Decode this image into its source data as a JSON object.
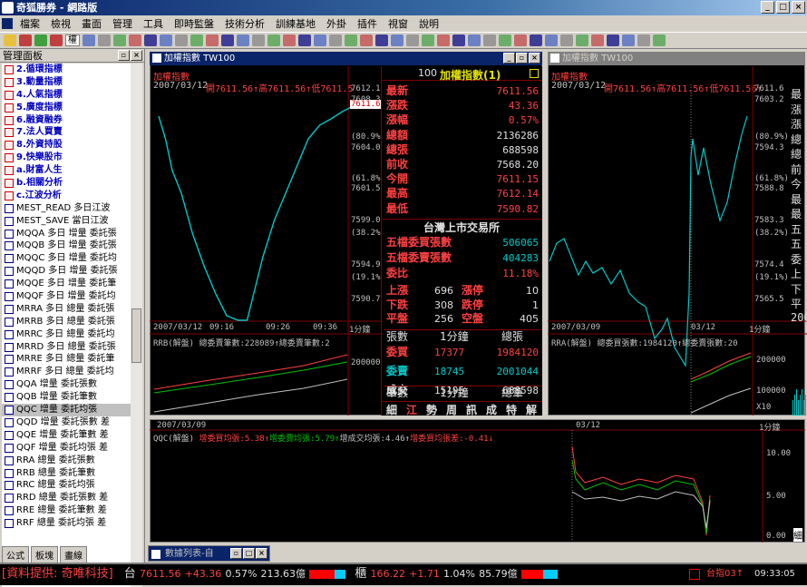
{
  "app_title": "奇狐勝券 - 網路版",
  "menu": [
    "檔案",
    "檢視",
    "畫面",
    "管理",
    "工具",
    "即時監盤",
    "技術分析",
    "訓練基地",
    "外掛",
    "插件",
    "視窗",
    "說明"
  ],
  "toolbar": {
    "select_value": "權"
  },
  "panel": {
    "title": "管理面板",
    "items": [
      {
        "label": "2.循環指標",
        "cat": true
      },
      {
        "label": "3.動量指標",
        "cat": true
      },
      {
        "label": "4.人氣指標",
        "cat": true
      },
      {
        "label": "5.廣度指標",
        "cat": true
      },
      {
        "label": "6.融資融券",
        "cat": true
      },
      {
        "label": "7.法人買賣",
        "cat": true
      },
      {
        "label": "8.外資持股",
        "cat": true
      },
      {
        "label": "9.快樂股市",
        "cat": true
      },
      {
        "label": "a.財富人生",
        "cat": true
      },
      {
        "label": "b.相關分析",
        "cat": true
      },
      {
        "label": "c.江波分析",
        "cat": true
      },
      {
        "label": "MEST_READ 多日江波"
      },
      {
        "label": "MEST_SAVE 當日江波"
      },
      {
        "label": "MQQA 多日 增量 委託張"
      },
      {
        "label": "MQQB 多日 增量 委託張"
      },
      {
        "label": "MQQC 多日 增量 委託均"
      },
      {
        "label": "MQQD 多日 增量 委託張"
      },
      {
        "label": "MQQE 多日 增量 委託筆"
      },
      {
        "label": "MQQF 多日 增量 委託均"
      },
      {
        "label": "MRRA 多日 總量 委託張"
      },
      {
        "label": "MRRB 多日 總量 委託張"
      },
      {
        "label": "MRRC 多日 總量 委託均"
      },
      {
        "label": "MRRD 多日 總量 委託張"
      },
      {
        "label": "MRRE 多日 總量 委託筆"
      },
      {
        "label": "MRRF 多日 總量 委託均"
      },
      {
        "label": "QQA 增量 委託張數"
      },
      {
        "label": "QQB 增量 委託筆數"
      },
      {
        "label": "QQC 增量 委託均張",
        "sel": true
      },
      {
        "label": "QQD 增量 委託張數 差"
      },
      {
        "label": "QQE 增量 委託筆數 差"
      },
      {
        "label": "QQF 增量 委託均張 差"
      },
      {
        "label": "RRA 總量 委託張數"
      },
      {
        "label": "RRB 總量 委託筆數"
      },
      {
        "label": "RRC 總量 委託均張"
      },
      {
        "label": "RRD 總量 委託張數 差"
      },
      {
        "label": "RRE 總量 委託筆數 差"
      },
      {
        "label": "RRF 總量 委託均張 差"
      }
    ],
    "tabs": [
      "公式",
      "板塊",
      "畫線"
    ]
  },
  "win1": {
    "title": "加權指數 TW100",
    "label": "加權指數",
    "date": "2007/03/12",
    "ohlc": "開7611.56↑高7611.56↑低7611.5",
    "yticks": [
      "7612.1",
      "7608.3",
      "(80.9%)",
      "7604.0",
      "(61.8%)",
      "7601.5",
      "7599.0",
      "(38.2%)",
      "7594.9",
      "(19.1%)",
      "7590.7"
    ],
    "price_tag": "7611.6",
    "xaxis": [
      "2007/03/12",
      "09:16",
      "09:26",
      "09:36",
      "1分鐘"
    ],
    "sub": "RRB(解盤) 總委賣筆數:228089↑總委賣筆數:2",
    "sub_tick": "200000"
  },
  "quote": {
    "header_code": "100",
    "header_name": "加權指數(1)",
    "rows": [
      [
        "最新",
        "7611.56",
        "#ff4040"
      ],
      [
        "漲跌",
        "43.36",
        "#ff4040"
      ],
      [
        "漲幅",
        "0.57%",
        "#ff4040"
      ],
      [
        "總額",
        "2136286",
        "#e0e0e0"
      ],
      [
        "總張",
        "688598",
        "#e0e0e0"
      ],
      [
        "前收",
        "7568.20",
        "#e0e0e0"
      ],
      [
        "今開",
        "7611.15",
        "#ff4040"
      ],
      [
        "最高",
        "7612.14",
        "#ff4040"
      ],
      [
        "最低",
        "7590.82",
        "#ff4040"
      ]
    ],
    "exchange": "台灣上市交易所",
    "rows2": [
      [
        "五檔委買張數",
        "506065",
        "#00c8c8"
      ],
      [
        "五檔委賣張數",
        "404283",
        "#00c8c8"
      ],
      [
        "委比",
        "11.18%",
        "#ff4040"
      ]
    ],
    "updown": [
      [
        "上漲",
        "696",
        "漲停",
        "10"
      ],
      [
        "下跌",
        "308",
        "跌停",
        "1"
      ],
      [
        "平盤",
        "256",
        "空盤",
        "405"
      ]
    ],
    "tbl_head": [
      "張數",
      "1分鐘",
      "總張"
    ],
    "tbl": [
      [
        "委買",
        "17377",
        "1984120",
        "#ff4040"
      ],
      [
        "委賣",
        "18745",
        "2001044",
        "#00c8c8"
      ],
      [
        "成交",
        "15195",
        "688598",
        "#e0e0e0"
      ]
    ],
    "tbl_head2": [
      "筆數",
      "1分鐘",
      "總筆"
    ],
    "tabs": [
      "細",
      "江",
      "勢",
      "周",
      "訊",
      "成",
      "特",
      "解"
    ]
  },
  "win2": {
    "title": "加權指數 TW100",
    "label": "加權指數",
    "date": "2007/03/12",
    "ohlc": "開7611.56↑高7611.56↑低7611.56↑",
    "yticks": [
      "7611.6",
      "7603.2",
      "(80.9%)",
      "7594.3",
      "(61.8%)",
      "7588.8",
      "7583.3",
      "(38.2%)",
      "7574.4",
      "(19.1%)",
      "7565.5"
    ],
    "right_col": [
      "最",
      "漲",
      "漲",
      "總",
      "總",
      "前",
      "今",
      "最",
      "最",
      "五",
      "五",
      "委",
      "上",
      "下",
      "平",
      "200"
    ],
    "xaxis": [
      "2007/03/09",
      "03/12",
      "1分鐘"
    ],
    "sub": "RRA(解盤) 總委買張數:1984120↑總委賣張數:20",
    "sub_ticks": [
      "200000",
      "100000"
    ],
    "sub_foot": "X10"
  },
  "win3": {
    "date_left": "2007/03/09",
    "date_mid": "03/12",
    "period": "1分鐘",
    "legend": [
      [
        "QQC(解盤) ",
        "#c0c0c0"
      ],
      [
        "增委買均張:5.38↑",
        "#ff4040"
      ],
      [
        "增委賣均張:5.79↑",
        "#00c000"
      ],
      [
        "增成交均張:4.46↑",
        "#c0c0c0"
      ],
      [
        "增委買均張差:-0.41↓",
        "#ff4040"
      ]
    ],
    "yticks": [
      "10.00",
      "5.00",
      "0.00"
    ],
    "corner": "細"
  },
  "taskbar": {
    "label": "數據列表-自"
  },
  "status": {
    "provider": "[資料提供: 奇唯科技]",
    "tw_label": "台",
    "tw_value": "7611.56",
    "tw_chg": "+43.36",
    "tw_pct": "0.57%",
    "tw_amt": "213.63億",
    "otc_label": "櫃",
    "otc_value": "166.22",
    "otc_chg": "+1.71",
    "otc_pct": "1.04%",
    "otc_amt": "85.79億",
    "ticker": "台指03↑",
    "clock": "09:33:05"
  },
  "colors": {
    "up": "#ff4040",
    "down": "#00c8c8",
    "title_active": "#0a246a"
  }
}
